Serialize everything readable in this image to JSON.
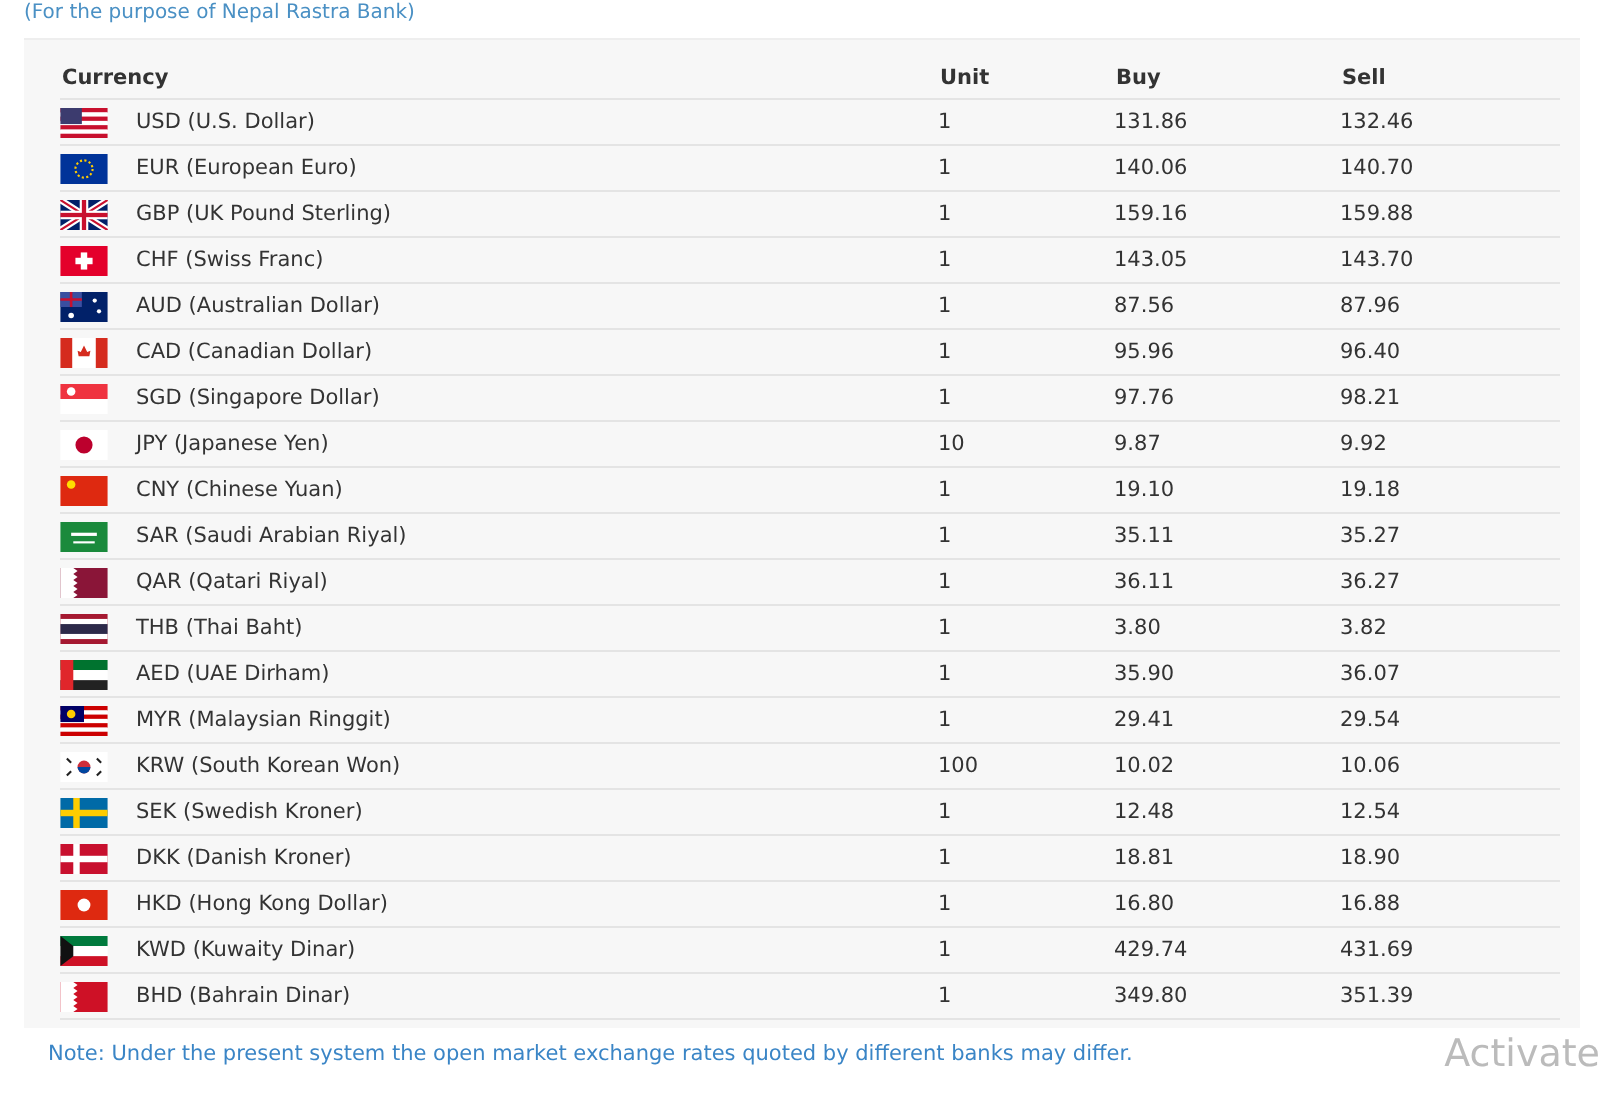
{
  "subtitle": "(For the purpose of Nepal Rastra Bank)",
  "table": {
    "columns": [
      "Currency",
      "Unit",
      "Buy",
      "Sell"
    ],
    "rows": [
      {
        "currency": "USD (U.S. Dollar)",
        "unit": "1",
        "buy": "131.86",
        "sell": "132.46"
      },
      {
        "currency": "EUR (European Euro)",
        "unit": "1",
        "buy": "140.06",
        "sell": "140.70"
      },
      {
        "currency": "GBP (UK Pound Sterling)",
        "unit": "1",
        "buy": "159.16",
        "sell": "159.88"
      },
      {
        "currency": "CHF (Swiss Franc)",
        "unit": "1",
        "buy": "143.05",
        "sell": "143.70"
      },
      {
        "currency": "AUD (Australian Dollar)",
        "unit": "1",
        "buy": "87.56",
        "sell": "87.96"
      },
      {
        "currency": "CAD (Canadian Dollar)",
        "unit": "1",
        "buy": "95.96",
        "sell": "96.40"
      },
      {
        "currency": "SGD (Singapore Dollar)",
        "unit": "1",
        "buy": "97.76",
        "sell": "98.21"
      },
      {
        "currency": "JPY (Japanese Yen)",
        "unit": "10",
        "buy": "9.87",
        "sell": "9.92"
      },
      {
        "currency": "CNY (Chinese Yuan)",
        "unit": "1",
        "buy": "19.10",
        "sell": "19.18"
      },
      {
        "currency": "SAR (Saudi Arabian Riyal)",
        "unit": "1",
        "buy": "35.11",
        "sell": "35.27"
      },
      {
        "currency": "QAR (Qatari Riyal)",
        "unit": "1",
        "buy": "36.11",
        "sell": "36.27"
      },
      {
        "currency": "THB (Thai Baht)",
        "unit": "1",
        "buy": "3.80",
        "sell": "3.82"
      },
      {
        "currency": "AED (UAE Dirham)",
        "unit": "1",
        "buy": "35.90",
        "sell": "36.07"
      },
      {
        "currency": "MYR (Malaysian Ringgit)",
        "unit": "1",
        "buy": "29.41",
        "sell": "29.54"
      },
      {
        "currency": "KRW (South Korean Won)",
        "unit": "100",
        "buy": "10.02",
        "sell": "10.06"
      },
      {
        "currency": "SEK (Swedish Kroner)",
        "unit": "1",
        "buy": "12.48",
        "sell": "12.54"
      },
      {
        "currency": "DKK (Danish Kroner)",
        "unit": "1",
        "buy": "18.81",
        "sell": "18.90"
      },
      {
        "currency": "HKD (Hong Kong Dollar)",
        "unit": "1",
        "buy": "16.80",
        "sell": "16.88"
      },
      {
        "currency": "KWD (Kuwaity Dinar)",
        "unit": "1",
        "buy": "429.74",
        "sell": "431.69"
      },
      {
        "currency": "BHD (Bahrain Dinar)",
        "unit": "1",
        "buy": "349.80",
        "sell": "351.39"
      }
    ]
  },
  "note": "Note: Under the present system the open market exchange rates quoted by different banks may differ.",
  "os_notice": "Activate"
}
